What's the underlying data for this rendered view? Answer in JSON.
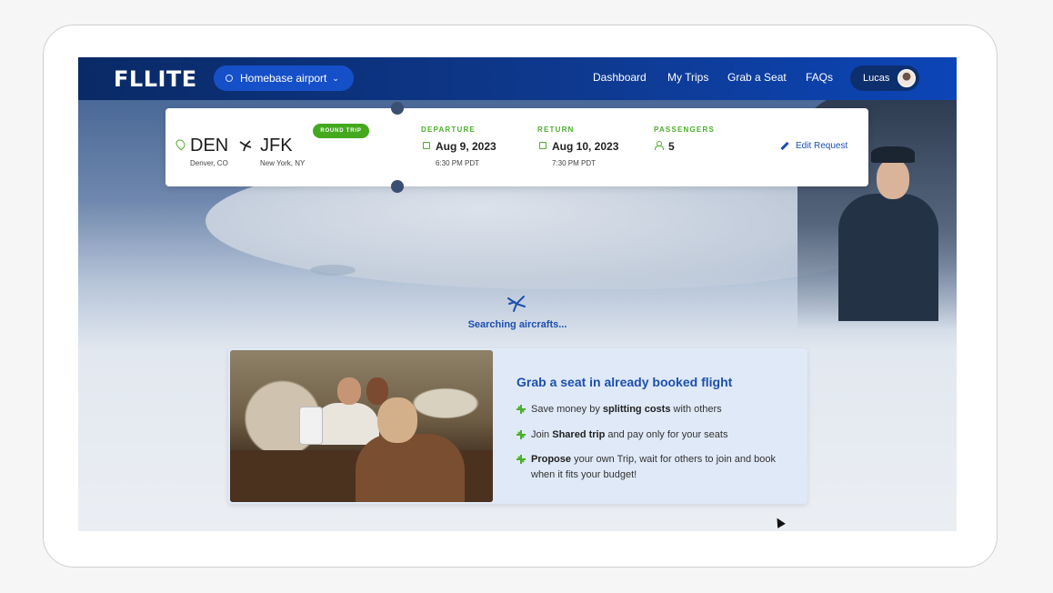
{
  "nav": {
    "logo": "FLLITE",
    "airport_label": "Homebase airport",
    "links": [
      "Dashboard",
      "My Trips",
      "Grab a Seat",
      "FAQs"
    ],
    "user": "Lucas"
  },
  "trip": {
    "from_code": "DEN",
    "from_city": "Denver, CO",
    "to_code": "JFK",
    "to_city": "New York, NY",
    "badge": "ROUND TRIP",
    "departure_label": "DEPARTURE",
    "departure_date": "Aug 9, 2023",
    "departure_time": "6:30 PM PDT",
    "return_label": "RETURN",
    "return_date": "Aug 10, 2023",
    "return_time": "7:30 PM PDT",
    "passengers_label": "PASSENGERS",
    "passengers": "5",
    "edit_label": "Edit Request"
  },
  "status": {
    "searching": "Searching aircrafts..."
  },
  "promo": {
    "title": "Grab a seat in already booked flight",
    "bullets": [
      {
        "pre": "Save money by ",
        "bold": "splitting costs",
        "post": " with others"
      },
      {
        "pre": "Join ",
        "bold": "Shared trip",
        "post": " and pay only for your seats"
      },
      {
        "pre": "",
        "bold": "Propose",
        "post": " your own Trip, wait for others to join and book when it fits your budget!"
      }
    ]
  },
  "colors": {
    "accent": "#1c4fae",
    "green": "#4caf2c",
    "nav": "#0e3a92"
  },
  "icons": [
    "location-pin-icon",
    "chevron-down-icon",
    "plane-icon",
    "calendar-icon",
    "person-icon",
    "pencil-icon",
    "plus-plane-icon"
  ]
}
